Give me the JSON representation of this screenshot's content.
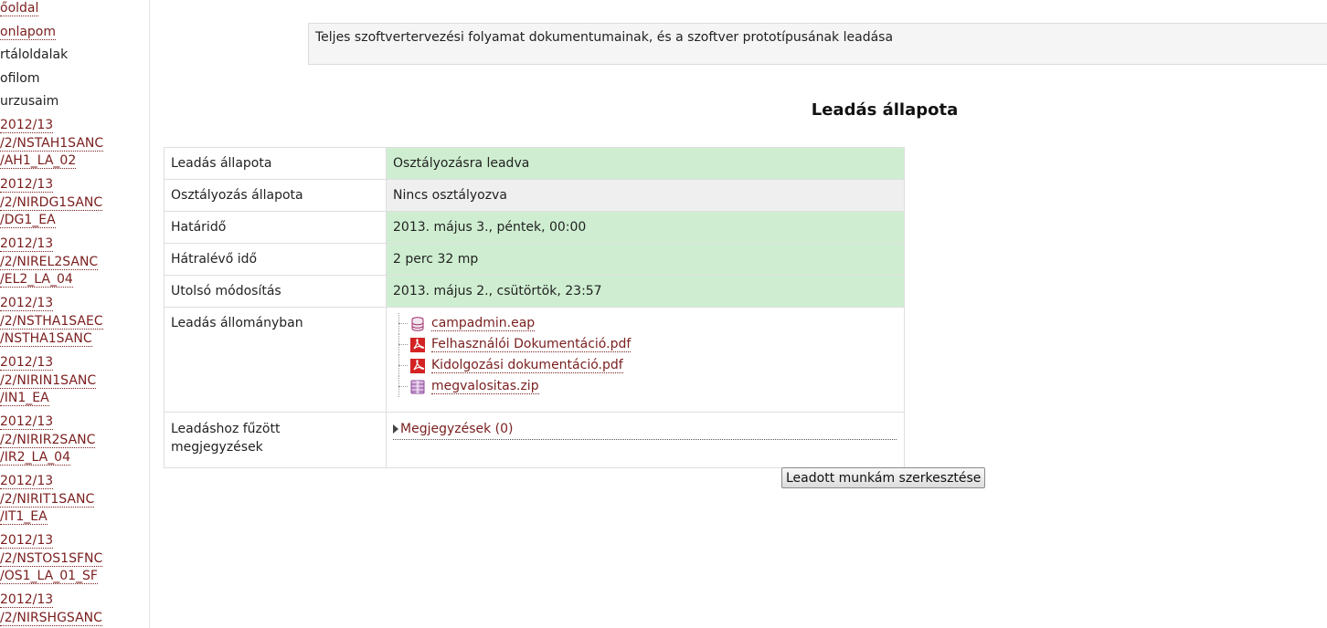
{
  "sidebar": {
    "nav": [
      {
        "label": "őoldal",
        "link": true
      },
      {
        "label": "onlapom",
        "link": true
      },
      {
        "label": "rtáloldalak",
        "link": false
      },
      {
        "label": "ofilom",
        "link": false
      },
      {
        "label": "urzusaim",
        "link": false
      }
    ],
    "courses": [
      {
        "line1": "2012/13",
        "line2": "/2/NSTAH1SANC",
        "line3": "/AH1_LA_02"
      },
      {
        "line1": "2012/13",
        "line2": "/2/NIRDG1SANC",
        "line3": "/DG1_EA"
      },
      {
        "line1": "2012/13",
        "line2": "/2/NIREL2SANC",
        "line3": "/EL2_LA_04"
      },
      {
        "line1": "2012/13",
        "line2": "/2/NSTHA1SAEC",
        "line3": "/NSTHA1SANC"
      },
      {
        "line1": "2012/13",
        "line2": "/2/NIRIN1SANC",
        "line3": "/IN1_EA"
      },
      {
        "line1": "2012/13",
        "line2": "/2/NIRIR2SANC",
        "line3": "/IR2_LA_04"
      },
      {
        "line1": "2012/13",
        "line2": "/2/NIRIT1SANC",
        "line3": "/IT1_EA"
      },
      {
        "line1": "2012/13",
        "line2": "/2/NSTOS1SFNC",
        "line3": "/OS1_LA_01_SF"
      },
      {
        "line1": "2012/13",
        "line2": "/2/NIRSHGSANC",
        "line3": ""
      }
    ]
  },
  "intro": {
    "text": "Teljes szoftvertervezési folyamat dokumentumainak, és a szoftver prototípusának leadása"
  },
  "status": {
    "heading": "Leadás állapota",
    "rows": [
      {
        "label": "Leadás állapota",
        "value": "Osztályozásra leadva"
      },
      {
        "label": "Osztályozás állapota",
        "value": "Nincs osztályozva"
      },
      {
        "label": "Határidő",
        "value": "2013. május 3., péntek, 00:00"
      },
      {
        "label": "Hátralévő idő",
        "value": "2 perc 32 mp"
      },
      {
        "label": "Utolsó módosítás",
        "value": "2013. május 2., csütörtök, 23:57"
      }
    ],
    "files_label": "Leadás állományban",
    "files": [
      {
        "name": "campadmin.eap",
        "icon": "database-icon"
      },
      {
        "name": "Felhasználói Dokumentáció.pdf",
        "icon": "pdf-icon"
      },
      {
        "name": "Kidolgozási dokumentáció.pdf",
        "icon": "pdf-icon"
      },
      {
        "name": "megvalositas.zip",
        "icon": "archive-icon"
      }
    ],
    "notes_label_line1": "Leadáshoz fűzött",
    "notes_label_line2": "megjegyzések",
    "notes_link": "Megjegyzések (0)"
  },
  "actions": {
    "edit_button": "Leadott munkám szerkesztése"
  },
  "colors": {
    "link": "#7a1e1e",
    "submitted_bg": "#cfeed1",
    "ungraded_bg": "#efefef"
  }
}
